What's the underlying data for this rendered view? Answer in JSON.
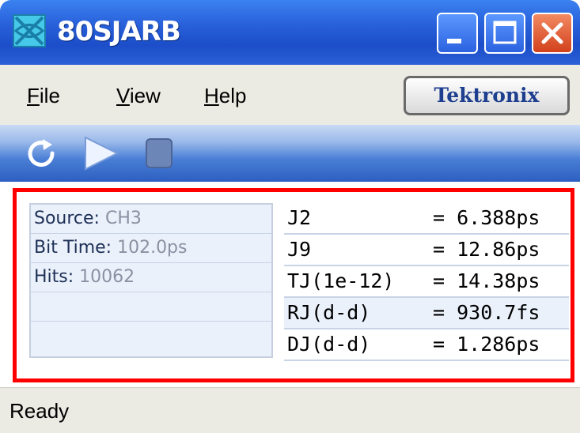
{
  "window": {
    "title": "80SJARB",
    "icons": {
      "app": "app-icon",
      "minimize": "minimize-icon",
      "maximize": "maximize-icon",
      "close": "close-icon"
    }
  },
  "menu": {
    "file": {
      "accel": "F",
      "rest": "ile"
    },
    "view": {
      "accel": "V",
      "rest": "iew"
    },
    "help": {
      "accel": "H",
      "rest": "elp"
    },
    "brand": "Tektronix"
  },
  "toolbar": {
    "icons": [
      "refresh-icon",
      "play-icon",
      "stop-icon"
    ]
  },
  "results": {
    "source_label": "Source: ",
    "source_value": "CH3",
    "bit_time_label": "Bit Time: ",
    "bit_time_value": "102.0ps",
    "hits_label": "Hits: ",
    "hits_value": "10062",
    "measurements": [
      {
        "name": "J2",
        "value": "= 6.388ps"
      },
      {
        "name": "J9",
        "value": "= 12.86ps"
      },
      {
        "name": "TJ(1e-12)",
        "value": "= 14.38ps"
      },
      {
        "name": "RJ(d-d)",
        "value": "= 930.7fs"
      },
      {
        "name": "DJ(d-d)",
        "value": "= 1.286ps"
      }
    ]
  },
  "status": {
    "text": "Ready"
  },
  "colors": {
    "titlebar": "#2a63dc",
    "highlight_border": "#ff0000",
    "close_button": "#d2411c",
    "value_gray": "#8a92a2",
    "table_fill": "#eaf1fb"
  }
}
